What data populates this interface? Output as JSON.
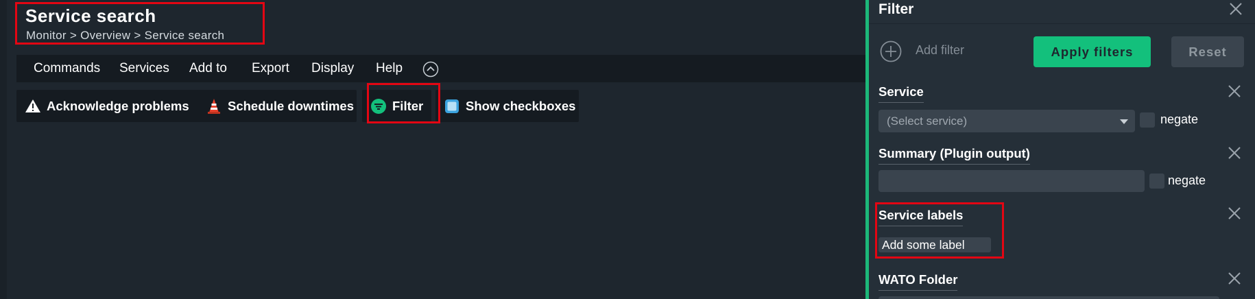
{
  "page": {
    "title": "Service search",
    "breadcrumb": {
      "parts": [
        "Monitor",
        "Overview",
        "Service search"
      ],
      "separator": ">"
    }
  },
  "menubar": {
    "items": [
      "Commands",
      "Services",
      "Add to",
      "Export",
      "Display",
      "Help"
    ],
    "collapse_icon": "chevron-up-circle-icon"
  },
  "toolbar": {
    "acknowledge_label": "Acknowledge problems",
    "downtimes_label": "Schedule downtimes",
    "filter_label": "Filter",
    "checkboxes_label": "Show checkboxes"
  },
  "filter_panel": {
    "title": "Filter",
    "add_filter_placeholder": "Add filter",
    "apply_label": "Apply filters",
    "reset_label": "Reset",
    "filters": [
      {
        "label": "Service",
        "select_placeholder": "(Select service)",
        "negate_label": "negate"
      },
      {
        "label": "Summary (Plugin output)",
        "value": "",
        "negate_label": "negate"
      },
      {
        "label": "Service labels",
        "input_placeholder": "Add some label"
      },
      {
        "label": "WATO Folder"
      }
    ]
  },
  "colors": {
    "accent_green": "#13c07c",
    "highlight_red": "#e30613",
    "background": "#1e262e",
    "panel_background": "#252f38"
  }
}
